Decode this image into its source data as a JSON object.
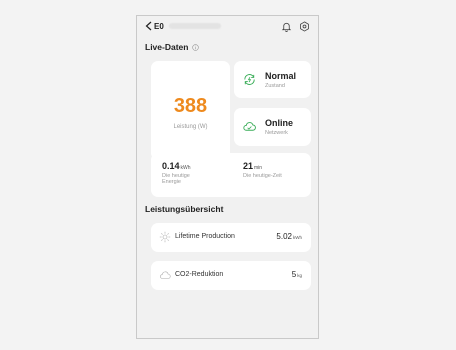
{
  "header": {
    "device_prefix": "E0",
    "icons": [
      "back-chevron-icon",
      "bell-icon",
      "settings-gear-icon"
    ]
  },
  "live": {
    "title": "Live-Daten",
    "power_value": "388",
    "power_label": "Leistung (W)",
    "status_main": "Normal",
    "status_sub": "Zustand",
    "network_main": "Online",
    "network_sub": "Netzwerk",
    "energy_value": "0.14",
    "energy_unit": "kWh",
    "energy_label_1": "Die heutige",
    "energy_label_2": "Energie",
    "time_value": "21",
    "time_unit": "min",
    "time_label": "Die heutige-Zeit"
  },
  "overview": {
    "title": "Leistungsübersicht",
    "items": [
      {
        "label": "Lifetime Production",
        "value": "5.02",
        "unit": "kWh",
        "icon": "sun-icon"
      },
      {
        "label": "CO2-Reduktion",
        "value": "5",
        "unit": "kg",
        "icon": "cloud-icon"
      }
    ]
  },
  "colors": {
    "power": "#ee8a1e",
    "normal": "#3cae5a",
    "online": "#3cae5a",
    "background": "#f1f1f1"
  }
}
